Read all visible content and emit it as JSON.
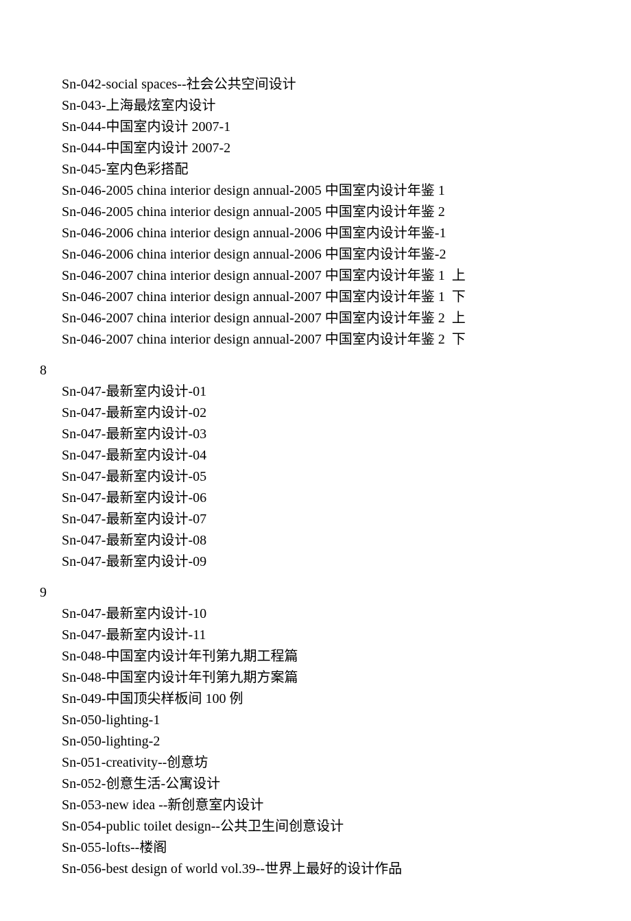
{
  "sections": [
    {
      "label": "",
      "items": [
        "Sn-042-social spaces--社会公共空间设计",
        "Sn-043-上海最炫室内设计",
        "Sn-044-中国室内设计 2007-1",
        "Sn-044-中国室内设计 2007-2",
        "Sn-045-室内色彩搭配",
        "Sn-046-2005 china interior design annual-2005 中国室内设计年鉴 1",
        "Sn-046-2005 china interior design annual-2005 中国室内设计年鉴 2",
        "Sn-046-2006 china interior design annual-2006 中国室内设计年鉴-1",
        "Sn-046-2006 china interior design annual-2006 中国室内设计年鉴-2",
        "Sn-046-2007 china interior design annual-2007 中国室内设计年鉴 1  上",
        "Sn-046-2007 china interior design annual-2007 中国室内设计年鉴 1  下",
        "Sn-046-2007 china interior design annual-2007 中国室内设计年鉴 2  上",
        "Sn-046-2007 china interior design annual-2007 中国室内设计年鉴 2  下"
      ]
    },
    {
      "label": "8",
      "items": [
        "Sn-047-最新室内设计-01",
        "Sn-047-最新室内设计-02",
        "Sn-047-最新室内设计-03",
        "Sn-047-最新室内设计-04",
        "Sn-047-最新室内设计-05",
        "Sn-047-最新室内设计-06",
        "Sn-047-最新室内设计-07",
        "Sn-047-最新室内设计-08",
        "Sn-047-最新室内设计-09"
      ]
    },
    {
      "label": "9",
      "items": [
        "Sn-047-最新室内设计-10",
        "Sn-047-最新室内设计-11",
        "Sn-048-中国室内设计年刊第九期工程篇",
        "Sn-048-中国室内设计年刊第九期方案篇",
        "Sn-049-中国顶尖样板间 100 例",
        "Sn-050-lighting-1",
        "Sn-050-lighting-2",
        "Sn-051-creativity--创意坊",
        "Sn-052-创意生活-公寓设计",
        "Sn-053-new idea --新创意室内设计",
        "Sn-054-public toilet design--公共卫生间创意设计",
        "Sn-055-lofts--楼阁",
        "Sn-056-best design of world vol.39--世界上最好的设计作品"
      ]
    }
  ]
}
